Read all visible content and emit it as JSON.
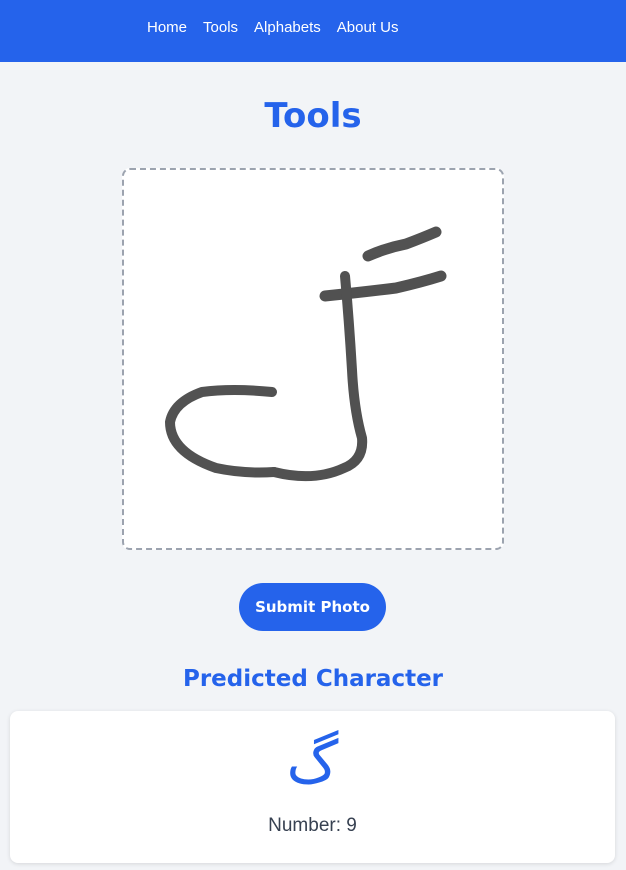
{
  "nav": {
    "items": [
      {
        "label": "Home"
      },
      {
        "label": "Tools"
      },
      {
        "label": "Alphabets"
      },
      {
        "label": "About Us"
      }
    ]
  },
  "page": {
    "title": "Tools"
  },
  "upload": {
    "image_description_icon": "handwritten-drawing-image"
  },
  "actions": {
    "submit_label": "Submit Photo"
  },
  "result": {
    "heading": "Predicted Character",
    "character": "گ",
    "number_text": "Number: 9"
  },
  "colors": {
    "accent": "#2563eb",
    "background": "#f2f4f7",
    "card": "#ffffff"
  }
}
